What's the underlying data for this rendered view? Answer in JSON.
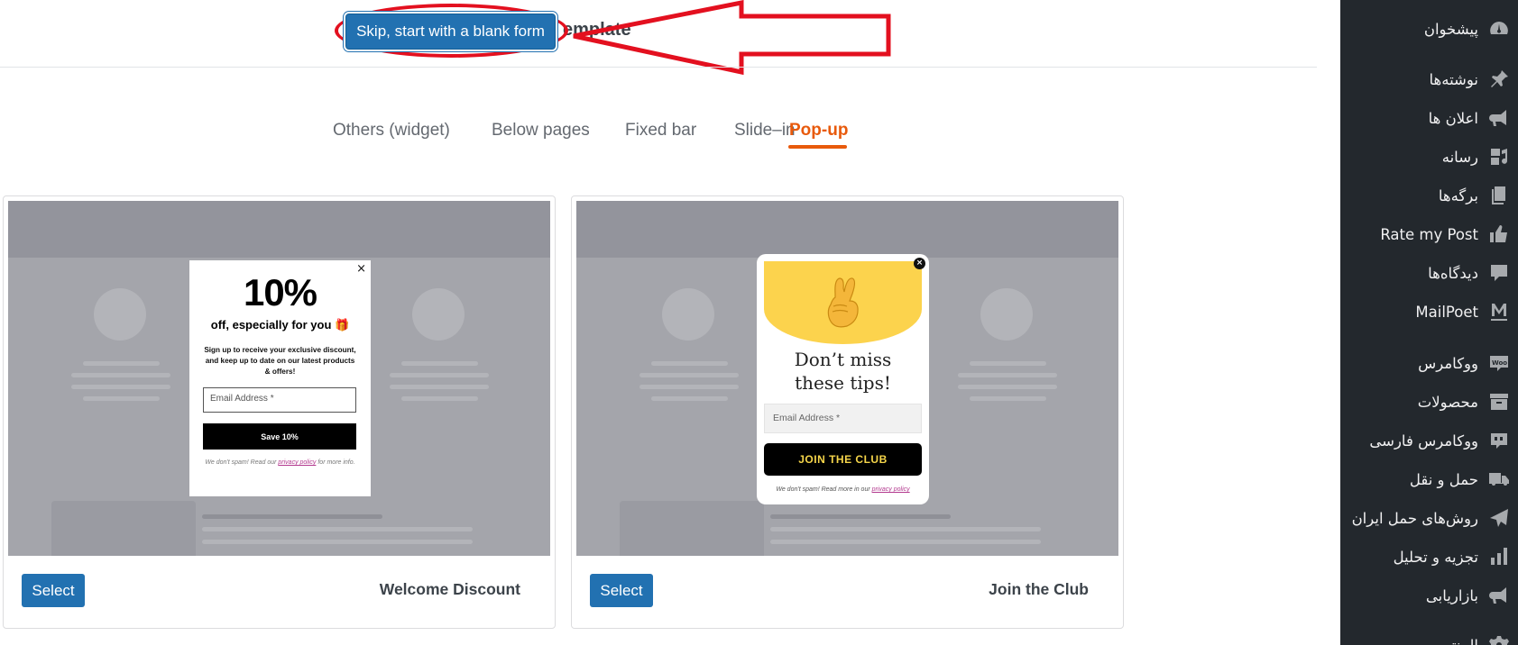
{
  "header": {
    "title_partial": "emplate",
    "blank_button": "Skip, start with a blank form"
  },
  "tabs": [
    {
      "label": "Others (widget)"
    },
    {
      "label": "Below pages"
    },
    {
      "label": "Fixed bar"
    },
    {
      "label": "Slide–in"
    },
    {
      "label": "Pop-up",
      "active": true
    }
  ],
  "templates": [
    {
      "name": "Welcome Discount",
      "select_label": "Select",
      "popup": {
        "close": "×",
        "big_text": "10%",
        "subtitle": "off, especially for you 🎁",
        "description": "Sign up to receive your exclusive discount, and keep up to date on our latest products & offers!",
        "email_placeholder": "Email Address *",
        "button": "Save 10%",
        "fine_pre": "We don't spam! Read our ",
        "fine_link": "privacy policy",
        "fine_post": " for more info."
      }
    },
    {
      "name": "Join the Club",
      "select_label": "Select",
      "popup": {
        "heading_line1": "Don’t miss",
        "heading_line2": "these tips!",
        "email_placeholder": "Email Address *",
        "button": "JOIN THE CLUB",
        "fine_pre": "We don't spam! Read more in our ",
        "fine_link": "privacy policy"
      }
    }
  ],
  "sidebar": {
    "items": [
      {
        "label": "پیشخوان",
        "icon": "dashboard-icon"
      },
      {
        "label": "نوشته‌ها",
        "icon": "pin-icon"
      },
      {
        "label": "اعلان ها",
        "icon": "megaphone-icon"
      },
      {
        "label": "رسانه",
        "icon": "media-icon"
      },
      {
        "label": "برگه‌ها",
        "icon": "pages-icon"
      },
      {
        "label": "Rate my Post",
        "icon": "thumbs-up-icon"
      },
      {
        "label": "دیدگاه‌ها",
        "icon": "comment-icon"
      },
      {
        "label": "MailPoet",
        "icon": "mailpoet-icon"
      },
      {
        "label": "ووکامرس",
        "icon": "woo-icon"
      },
      {
        "label": "محصولات",
        "icon": "archive-icon"
      },
      {
        "label": "ووکامرس فارسی",
        "icon": "quote-icon"
      },
      {
        "label": "حمل و نقل",
        "icon": "truck-icon"
      },
      {
        "label": "روش‌های حمل ایران",
        "icon": "plane-icon"
      },
      {
        "label": "تجزیه و تحلیل",
        "icon": "chart-icon"
      },
      {
        "label": "بازاریابی",
        "icon": "megaphone-icon"
      },
      {
        "label": "المنتور",
        "icon": "gear-icon"
      }
    ]
  },
  "colors": {
    "primary": "#2271b1",
    "accent": "#e85a0c",
    "annotation": "#e3101f",
    "sidebar_bg": "#23282d"
  }
}
